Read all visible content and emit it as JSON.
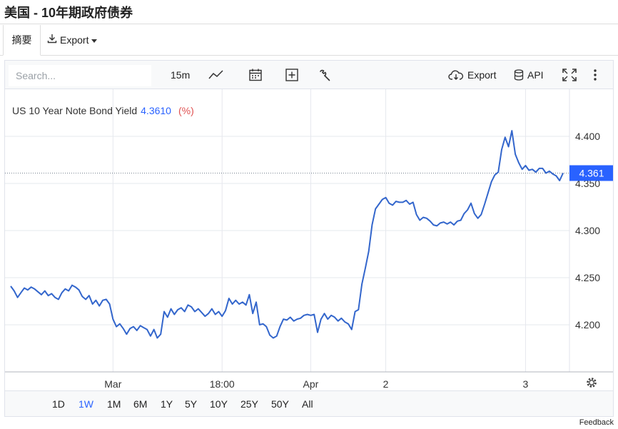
{
  "page": {
    "title": "美国 - 10年期政府债券"
  },
  "tabs": {
    "summary": "摘要",
    "export": "Export"
  },
  "toolbar": {
    "search_placeholder": "Search...",
    "interval": "15m",
    "export": "Export",
    "api": "API"
  },
  "periods": [
    "1D",
    "1W",
    "1M",
    "6M",
    "1Y",
    "5Y",
    "10Y",
    "25Y",
    "50Y",
    "All"
  ],
  "active_period": "1W",
  "footer": {
    "feedback": "Feedback"
  },
  "colors": {
    "line": "#3366cc",
    "accent": "#2962ff",
    "price_label_bg": "#2962ff",
    "unit": "#e05252"
  },
  "chart_data": {
    "type": "line",
    "legend": {
      "name": "US 10 Year Note Bond Yield",
      "value": "4.3610",
      "unit": "(%)"
    },
    "last_value": 4.361,
    "last_value_label": "4.361",
    "ylim": [
      4.15,
      4.45
    ],
    "y_ticks": [
      4.2,
      4.25,
      4.3,
      4.35,
      4.4
    ],
    "y_tick_labels": [
      "4.200",
      "4.250",
      "4.300",
      "4.350",
      "4.400"
    ],
    "x_ticks": [
      {
        "label": "Mar",
        "index": 30
      },
      {
        "label": "18:00",
        "index": 62
      },
      {
        "label": "Apr",
        "index": 88
      },
      {
        "label": "2",
        "index": 110
      },
      {
        "label": "3",
        "index": 151
      }
    ],
    "grid": true,
    "values": [
      4.241,
      4.236,
      4.229,
      4.234,
      4.239,
      4.237,
      4.24,
      4.238,
      4.235,
      4.232,
      4.236,
      4.231,
      4.233,
      4.229,
      4.227,
      4.234,
      4.238,
      4.236,
      4.242,
      4.24,
      4.237,
      4.23,
      4.227,
      4.231,
      4.222,
      4.226,
      4.22,
      4.226,
      4.227,
      4.222,
      4.206,
      4.198,
      4.201,
      4.196,
      4.19,
      4.196,
      4.198,
      4.194,
      4.199,
      4.197,
      4.195,
      4.188,
      4.195,
      4.186,
      4.19,
      4.214,
      4.208,
      4.217,
      4.211,
      4.216,
      4.218,
      4.214,
      4.221,
      4.219,
      4.214,
      4.217,
      4.213,
      4.209,
      4.212,
      4.217,
      4.211,
      4.214,
      4.209,
      4.215,
      4.228,
      4.222,
      4.226,
      4.222,
      4.224,
      4.221,
      4.232,
      4.212,
      4.224,
      4.2,
      4.201,
      4.198,
      4.189,
      4.186,
      4.188,
      4.198,
      4.206,
      4.205,
      4.208,
      4.204,
      4.206,
      4.207,
      4.21,
      4.211,
      4.21,
      4.211,
      4.192,
      4.206,
      4.212,
      4.206,
      4.21,
      4.208,
      4.204,
      4.207,
      4.203,
      4.201,
      4.195,
      4.214,
      4.216,
      4.243,
      4.26,
      4.278,
      4.306,
      4.323,
      4.328,
      4.333,
      4.335,
      4.329,
      4.327,
      4.331,
      4.33,
      4.33,
      4.332,
      4.328,
      4.33,
      4.317,
      4.311,
      4.314,
      4.313,
      4.31,
      4.306,
      4.305,
      4.308,
      4.309,
      4.307,
      4.309,
      4.306,
      4.31,
      4.311,
      4.318,
      4.322,
      4.329,
      4.318,
      4.313,
      4.317,
      4.328,
      4.34,
      4.352,
      4.359,
      4.362,
      4.386,
      4.399,
      4.389,
      4.406,
      4.381,
      4.372,
      4.365,
      4.369,
      4.364,
      4.365,
      4.362,
      4.366,
      4.366,
      4.361,
      4.363,
      4.36,
      4.358,
      4.353,
      4.361
    ]
  }
}
